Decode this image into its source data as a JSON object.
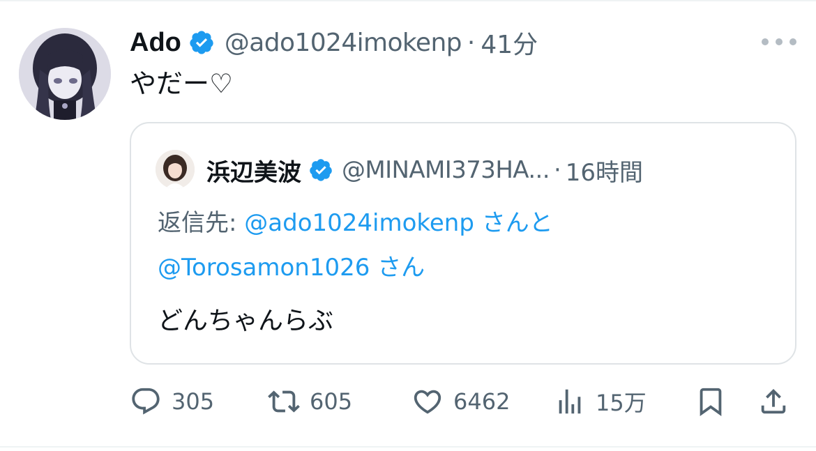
{
  "tweet": {
    "author": {
      "display_name": "Ado",
      "handle": "@ado1024imokenp",
      "verified": true,
      "avatar": "avatar-dark-hair-illustration"
    },
    "separator": "·",
    "time": "41分",
    "text": "やだー♡",
    "more_icon": "more-horizontal-icon"
  },
  "quote": {
    "author": {
      "display_name": "浜辺美波",
      "handle": "@MINAMI373HA...",
      "verified": true,
      "avatar": "avatar-photo"
    },
    "separator": "·",
    "time": "16時間",
    "reply_prefix": "返信先:",
    "reply_to_1": "@ado1024imokenp",
    "reply_joiner": "さんと",
    "reply_to_2": "@Torosamon1026",
    "reply_suffix": "さん",
    "text": "どんちゃんらぶ"
  },
  "actions": {
    "replies": "305",
    "retweets": "605",
    "likes": "6462",
    "views": "15万"
  },
  "colors": {
    "text": "#0f1419",
    "muted": "#536471",
    "link": "#1d9bf0",
    "verified": "#1d9bf0",
    "border": "#dfe3e6"
  }
}
